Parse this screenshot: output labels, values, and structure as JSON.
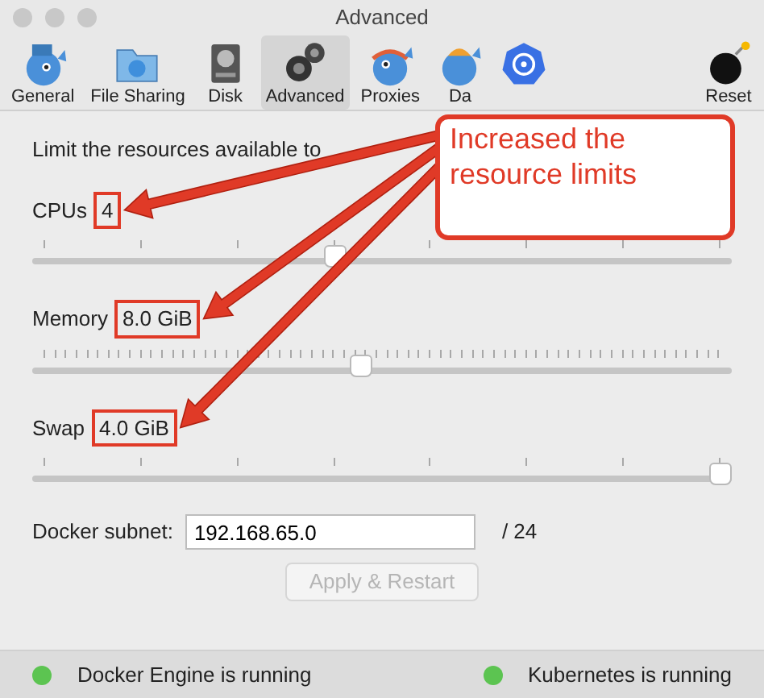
{
  "window": {
    "title": "Advanced"
  },
  "tabs": [
    {
      "label": "General",
      "selected": false
    },
    {
      "label": "File Sharing",
      "selected": false
    },
    {
      "label": "Disk",
      "selected": false
    },
    {
      "label": "Advanced",
      "selected": true
    },
    {
      "label": "Proxies",
      "selected": false
    },
    {
      "label": "Da",
      "selected": false
    },
    {
      "selected": false
    },
    {
      "label": "Reset",
      "selected": false
    }
  ],
  "intro": "Limit the resources available to",
  "sliders": [
    {
      "label": "CPUs",
      "value": "4",
      "level": 0.43
    },
    {
      "label": "Memory",
      "value": "8.0 GiB",
      "level": 0.47
    },
    {
      "label": "Swap",
      "value": "4.0 GiB",
      "level": 1.0
    }
  ],
  "subnet": {
    "label": "Docker subnet:",
    "value": "192.168.65.0",
    "suffix": "/ 24"
  },
  "apply_button": {
    "label": "Apply & Restart",
    "disabled": true
  },
  "status_bar": [
    {
      "text": "Docker Engine is running",
      "color": "#5cc451"
    },
    {
      "text": "Kubernetes is running",
      "color": "#5cc451"
    }
  ],
  "annotation": {
    "text": "Increased the resource limits"
  }
}
